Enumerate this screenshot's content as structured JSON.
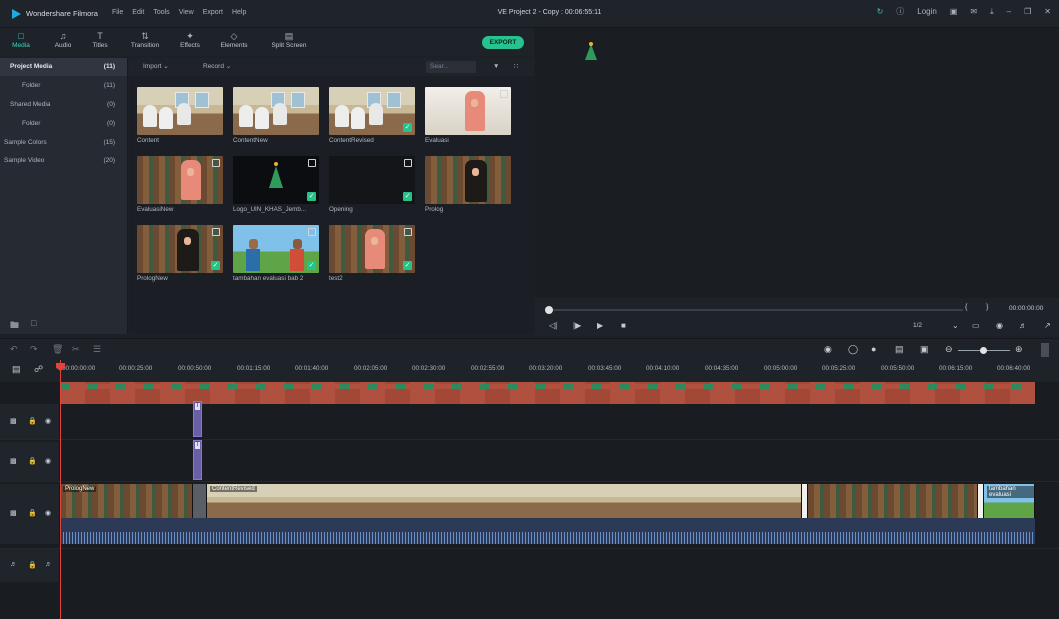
{
  "titlebar": {
    "app_name": "Wondershare Filmora",
    "menu": [
      "File",
      "Edit",
      "Tools",
      "View",
      "Export",
      "Help"
    ],
    "project": "VE Project 2 - Copy : 00:06:55:11",
    "login": "Login"
  },
  "toolbar": {
    "items": [
      {
        "icon": "media-icon",
        "label": "Media"
      },
      {
        "icon": "audio-icon",
        "label": "Audio"
      },
      {
        "icon": "titles-icon",
        "label": "Titles"
      },
      {
        "icon": "transition-icon",
        "label": "Transition"
      },
      {
        "icon": "effects-icon",
        "label": "Effects"
      },
      {
        "icon": "elements-icon",
        "label": "Elements"
      },
      {
        "icon": "split-screen-icon",
        "label": "Split Screen"
      }
    ],
    "export": "EXPORT"
  },
  "sidebar": {
    "items": [
      {
        "label": "Project Media",
        "count": "(11)"
      },
      {
        "label": "Folder",
        "count": "(11)"
      },
      {
        "label": "Shared Media",
        "count": "(0)"
      },
      {
        "label": "Folder",
        "count": "(0)"
      },
      {
        "label": "Sample Colors",
        "count": "(15)"
      },
      {
        "label": "Sample Video",
        "count": "(20)"
      }
    ]
  },
  "mediabar": {
    "import": "Import",
    "record": "Record",
    "search_placeholder": "Sear..."
  },
  "media": [
    {
      "name": "Content"
    },
    {
      "name": "ContentNew"
    },
    {
      "name": "ContentRevised"
    },
    {
      "name": "Evaluasi"
    },
    {
      "name": "EvaluasiNew"
    },
    {
      "name": "Logo_UIN_KHAS_Jemb..."
    },
    {
      "name": "Opening"
    },
    {
      "name": "Prolog"
    },
    {
      "name": "PrologNew"
    },
    {
      "name": "tambahan evaluasi bab 2"
    },
    {
      "name": "test2"
    }
  ],
  "preview": {
    "timecode": "00:00:00:00",
    "quality": "1/2",
    "brace_open": "{",
    "brace_close": "}"
  },
  "ruler": [
    "00:00:00:00",
    "00:00:25:00",
    "00:00:50:00",
    "00:01:15:00",
    "00:01:40:00",
    "00:02:05:00",
    "00:02:30:00",
    "00:02:55:00",
    "00:03:20:00",
    "00:03:45:00",
    "00:04:10:00",
    "00:04:35:00",
    "00:05:00:00",
    "00:05:25:00",
    "00:05:50:00",
    "00:06:15:00",
    "00:06:40:00"
  ],
  "clips": {
    "titles": [
      "T",
      "T"
    ],
    "video": [
      {
        "label": "PrologNew"
      },
      {
        "label": "ContentRevised"
      },
      {
        "label": ""
      },
      {
        "label": "tambahan evaluasi"
      }
    ]
  }
}
